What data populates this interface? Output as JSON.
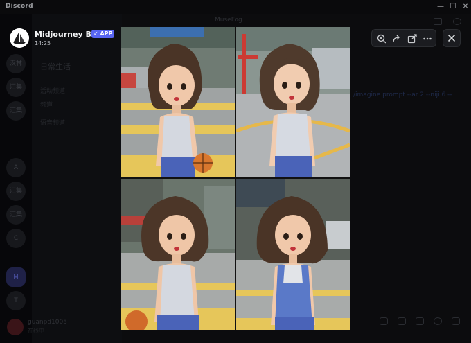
{
  "window": {
    "app_name": "Discord",
    "controls": {
      "minimize": "—",
      "maximize": "☐",
      "close": "✕"
    }
  },
  "background": {
    "channel_title": "MuseFog",
    "server_labels": [
      "汉林",
      "汇集",
      "汇集",
      "A",
      "汇集",
      "汇集",
      "C",
      "M",
      "T"
    ],
    "channel_name": "日常生活",
    "categories": [
      "活动频道",
      "频道",
      "语音频道"
    ],
    "chat_snippet": "/imagine prompt --ar 2 --niji 6 --",
    "user": {
      "name": "guanpd1005",
      "status": "在线中"
    }
  },
  "message": {
    "author": "Midjourney Bot",
    "badge": "✓ APP",
    "time": "14:25"
  },
  "image_grid": {
    "tiles": [
      "girl-portrait-1",
      "girl-portrait-2",
      "girl-portrait-3",
      "girl-portrait-4"
    ]
  },
  "toolbar": {
    "icons": [
      "zoom-in-icon",
      "forward-icon",
      "open-in-browser-icon",
      "more-icon",
      "close-icon"
    ]
  },
  "colors": {
    "accent": "#5865f2",
    "overlay": "#0c0c0e",
    "jersey": "#d4d8e0",
    "skirt": "#4a63b8"
  }
}
